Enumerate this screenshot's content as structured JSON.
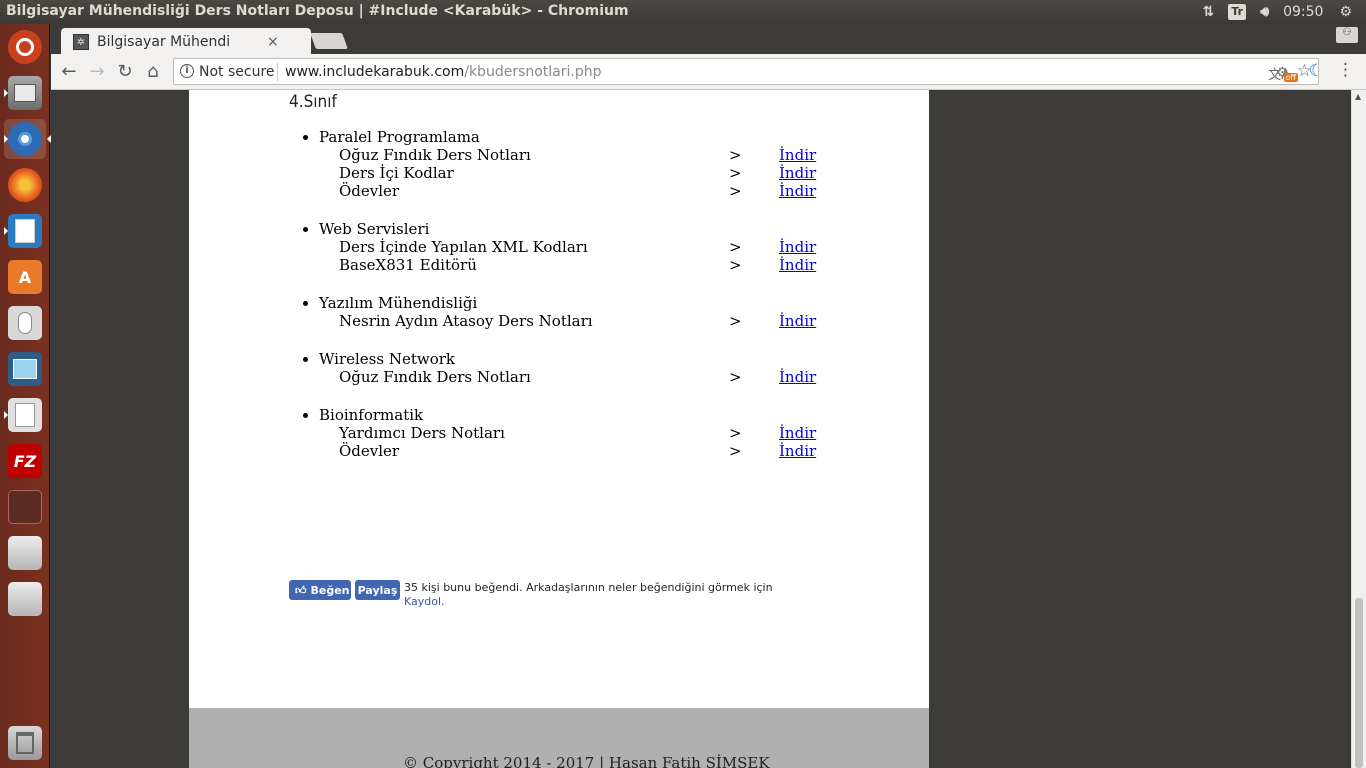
{
  "panel": {
    "window_title": "Bilgisayar Mühendisliği Ders Notları Deposu | #Include <Karabük> - Chromium",
    "keyboard_layout": "Tr",
    "clock": "09:50"
  },
  "launcher": {
    "items": [
      "ubuntu-dash-icon",
      "files-icon",
      "chromium-icon",
      "firefox-icon",
      "libreoffice-writer-icon",
      "software-center-icon",
      "mouse-icon",
      "system-monitor-icon",
      "text-editor-icon",
      "filezilla-icon",
      "workspace-switcher-icon",
      "drive-icon",
      "drive-icon",
      "trash-icon"
    ],
    "filezilla_label": "FZ"
  },
  "browser": {
    "tab_title": "Bilgisayar Mühendi",
    "tab_close": "×",
    "security_label": "Not secure",
    "url_host": "www.includekarabuk.com",
    "url_path": "/kbudersnotlari.php",
    "ext_badge": "off"
  },
  "page": {
    "section_title": "4.Sınıf",
    "courses": [
      {
        "title": "Paralel Programlama",
        "notes": [
          {
            "name": "Oğuz Fındık Ders Notları",
            "arrow": ">",
            "link": "İndir"
          },
          {
            "name": "Ders İçi Kodlar",
            "arrow": ">",
            "link": "İndir"
          },
          {
            "name": "Ödevler",
            "arrow": ">",
            "link": "İndir"
          }
        ]
      },
      {
        "title": "Web Servisleri",
        "notes": [
          {
            "name": "Ders İçinde Yapılan XML Kodları",
            "arrow": ">",
            "link": "İndir"
          },
          {
            "name": "BaseX831 Editörü",
            "arrow": ">",
            "link": "İndir"
          }
        ]
      },
      {
        "title": "Yazılım Mühendisliği",
        "notes": [
          {
            "name": "Nesrin Aydın Atasoy Ders Notları",
            "arrow": ">",
            "link": "İndir"
          }
        ]
      },
      {
        "title": "Wireless Network",
        "notes": [
          {
            "name": "Oğuz Fındık Ders Notları",
            "arrow": ">",
            "link": "İndir"
          }
        ]
      },
      {
        "title": "Bioinformatik",
        "notes": [
          {
            "name": "Yardımcı Ders Notları",
            "arrow": ">",
            "link": "İndir"
          },
          {
            "name": "Ödevler",
            "arrow": ">",
            "link": "İndir"
          }
        ]
      }
    ],
    "facebook": {
      "like_label": "Beğen",
      "share_label": "Paylaş",
      "count_text": "35 kişi bunu beğendi. Arkadaşlarının neler beğendiğini görmek için",
      "signup_text": "Kaydol."
    },
    "footer": {
      "copyright": "© Copyright 2014 - 2017 | Hasan Fatih ŞİMŞEK"
    }
  },
  "colors": {
    "launcher_bg": "#7a3020",
    "link": "#0000ee",
    "facebook_blue": "#4267b2",
    "footer_bg": "#b0b0b0"
  }
}
